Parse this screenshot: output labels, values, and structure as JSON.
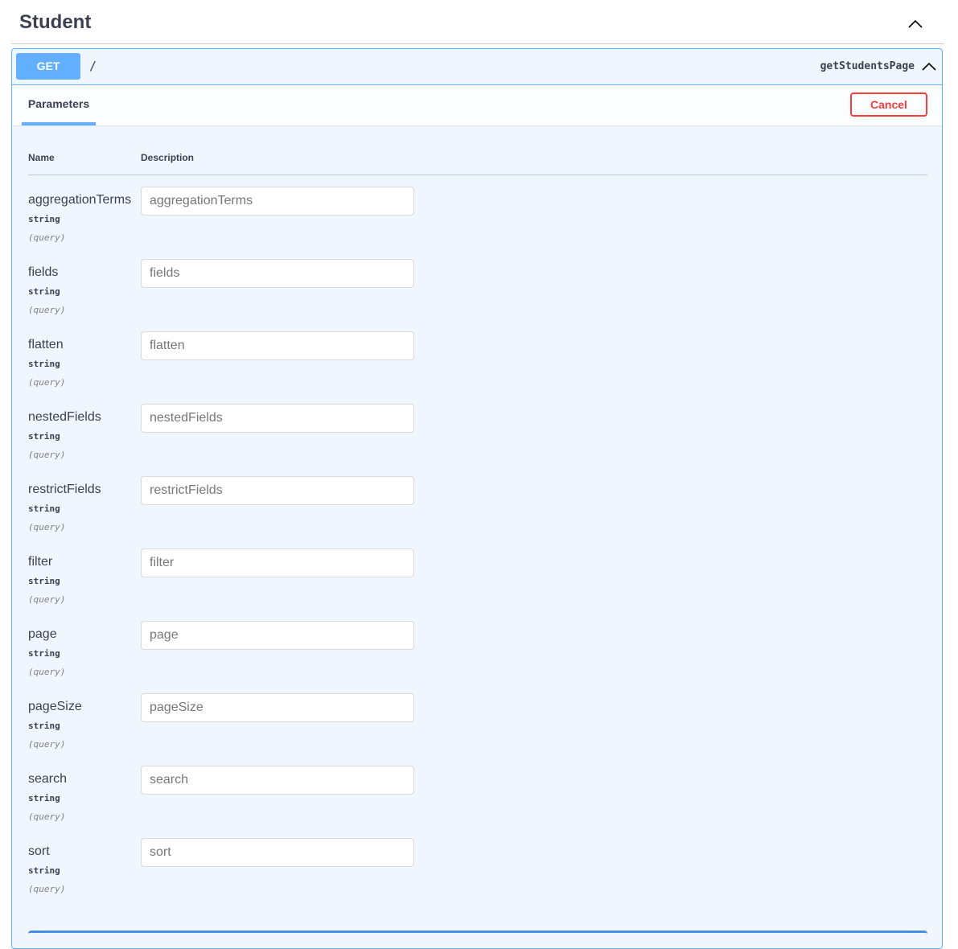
{
  "tag": {
    "title": "Student",
    "toggle_icon": "chevron-up-icon"
  },
  "operation": {
    "method": "GET",
    "path": "/",
    "operation_id": "getStudentsPage",
    "toggle_icon": "chevron-up-icon",
    "colors": {
      "accent": "#61affe",
      "background": "#eff6fe",
      "cancel": "#f93e3e"
    }
  },
  "parameters_section": {
    "tab_label": "Parameters",
    "cancel_label": "Cancel",
    "columns": {
      "name": "Name",
      "description": "Description"
    },
    "params": [
      {
        "name": "aggregationTerms",
        "type": "string",
        "in": "(query)",
        "placeholder": "aggregationTerms"
      },
      {
        "name": "fields",
        "type": "string",
        "in": "(query)",
        "placeholder": "fields"
      },
      {
        "name": "flatten",
        "type": "string",
        "in": "(query)",
        "placeholder": "flatten"
      },
      {
        "name": "nestedFields",
        "type": "string",
        "in": "(query)",
        "placeholder": "nestedFields"
      },
      {
        "name": "restrictFields",
        "type": "string",
        "in": "(query)",
        "placeholder": "restrictFields"
      },
      {
        "name": "filter",
        "type": "string",
        "in": "(query)",
        "placeholder": "filter"
      },
      {
        "name": "page",
        "type": "string",
        "in": "(query)",
        "placeholder": "page"
      },
      {
        "name": "pageSize",
        "type": "string",
        "in": "(query)",
        "placeholder": "pageSize"
      },
      {
        "name": "search",
        "type": "string",
        "in": "(query)",
        "placeholder": "search"
      },
      {
        "name": "sort",
        "type": "string",
        "in": "(query)",
        "placeholder": "sort"
      }
    ]
  }
}
